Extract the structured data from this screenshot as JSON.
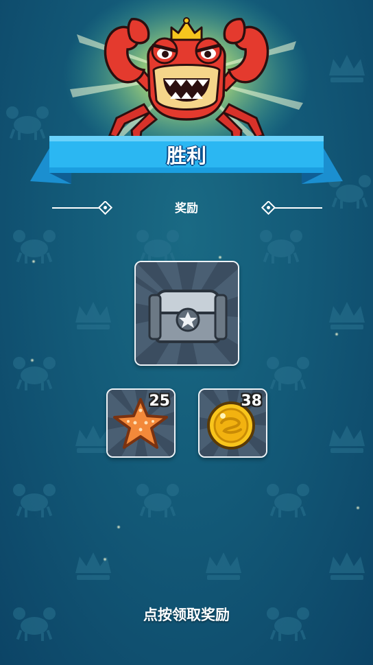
{
  "title": "胜利",
  "rewards_label": "奖励",
  "tap_hint": "点按领取奖励",
  "rewards": [
    {
      "id": "chest",
      "icon": "treasure-chest-icon",
      "count": ""
    },
    {
      "id": "starfish",
      "icon": "starfish-icon",
      "count": "25"
    },
    {
      "id": "coin",
      "icon": "gold-coin-icon",
      "count": "38"
    }
  ],
  "colors": {
    "background": "#135a78",
    "banner": "#2bb7f2",
    "banner_dark": "#1b8fd0",
    "crab": "#e43a2e",
    "crown": "#f7c51e",
    "tile_border": "#eef3f7"
  }
}
